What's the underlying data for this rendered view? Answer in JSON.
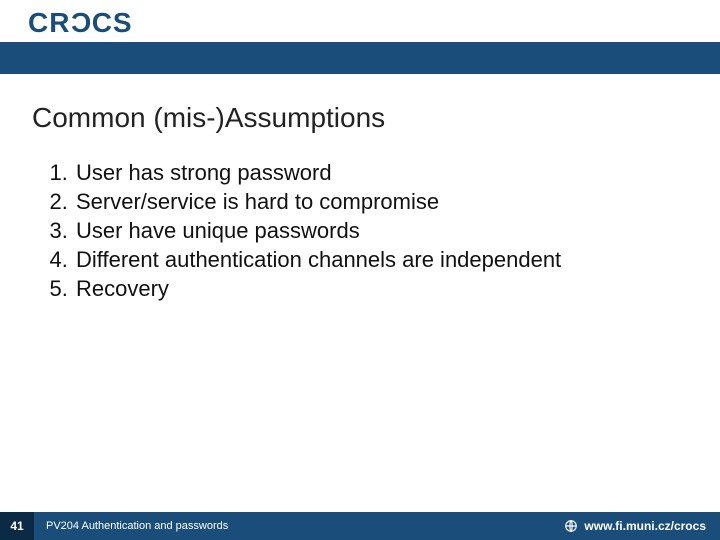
{
  "header": {
    "logo_prefix": "CR",
    "logo_c": "C",
    "logo_suffix": "CS"
  },
  "slide": {
    "title": "Common (mis-)Assumptions",
    "items": [
      "User has strong password",
      "Server/service is hard to compromise",
      "User have unique passwords",
      "Different authentication channels are independent",
      "Recovery"
    ]
  },
  "footer": {
    "page_number": "41",
    "subtitle": "PV204 Authentication and passwords",
    "url": "www.fi.muni.cz/crocs"
  }
}
